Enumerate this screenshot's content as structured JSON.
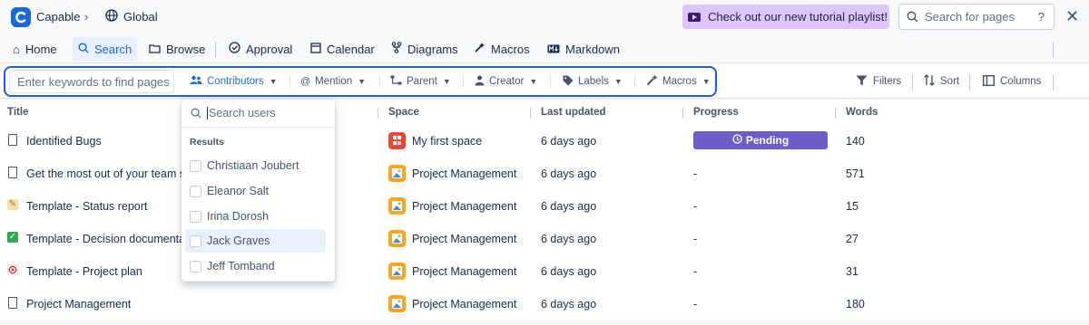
{
  "breadcrumb": {
    "app": "Capable",
    "space": "Global"
  },
  "promo": {
    "label": "Check out our new tutorial playlist!"
  },
  "top_search": {
    "placeholder": "Search for pages",
    "help": "?"
  },
  "nav": {
    "items": [
      {
        "label": "Home",
        "icon": "home-icon"
      },
      {
        "label": "Search",
        "icon": "search-icon",
        "active": true
      },
      {
        "label": "Browse",
        "icon": "folder-icon"
      },
      {
        "label": "Approval",
        "icon": "check-circle-icon"
      },
      {
        "label": "Calendar",
        "icon": "calendar-icon"
      },
      {
        "label": "Diagrams",
        "icon": "diagram-icon"
      },
      {
        "label": "Macros",
        "icon": "wand-icon"
      },
      {
        "label": "Markdown",
        "icon": "markdown-icon"
      }
    ]
  },
  "filters": {
    "keyword_placeholder": "Enter keywords to find pages",
    "chips": [
      {
        "label": "Contributors",
        "icon": "users-icon",
        "active": true
      },
      {
        "label": "Mention",
        "icon": "at-icon"
      },
      {
        "label": "Parent",
        "icon": "hierarchy-icon"
      },
      {
        "label": "Creator",
        "icon": "person-icon"
      },
      {
        "label": "Labels",
        "icon": "tag-icon"
      },
      {
        "label": "Macros",
        "icon": "wand-icon"
      }
    ],
    "right": [
      {
        "label": "Filters",
        "icon": "filter-icon"
      },
      {
        "label": "Sort",
        "icon": "sort-icon"
      },
      {
        "label": "Columns",
        "icon": "columns-icon"
      }
    ]
  },
  "table": {
    "columns": [
      "Title",
      "Space",
      "Last updated",
      "Progress",
      "Words"
    ],
    "rows": [
      {
        "title": "Identified Bugs",
        "icon": "document-icon",
        "space": "My first space",
        "space_icon": "red",
        "updated": "6 days ago",
        "progress": "Pending",
        "words": "140"
      },
      {
        "title": "Get the most out of your team s",
        "icon": "document-icon",
        "space": "Project Management",
        "space_icon": "orange",
        "updated": "6 days ago",
        "progress": "-",
        "words": "571"
      },
      {
        "title": "Template - Status report",
        "icon": "memo-emoji-icon",
        "space": "Project Management",
        "space_icon": "orange",
        "updated": "6 days ago",
        "progress": "-",
        "words": "15"
      },
      {
        "title": "Template - Decision documenta",
        "icon": "check-emoji-icon",
        "space": "Project Management",
        "space_icon": "orange",
        "updated": "6 days ago",
        "progress": "-",
        "words": "27"
      },
      {
        "title": "Template - Project plan",
        "icon": "target-emoji-icon",
        "space": "Project Management",
        "space_icon": "orange",
        "updated": "6 days ago",
        "progress": "-",
        "words": "31"
      },
      {
        "title": "Project Management",
        "icon": "document-icon",
        "space": "Project Management",
        "space_icon": "orange",
        "updated": "6 days ago",
        "progress": "-",
        "words": "180"
      }
    ]
  },
  "dropdown": {
    "placeholder": "Search users",
    "heading": "Results",
    "users": [
      "Christiaan Joubert",
      "Eleanor Salt",
      "Irina Dorosh",
      "Jack Graves",
      "Jeff Tomband"
    ]
  },
  "colors": {
    "accent": "#1868db",
    "outline": "#1f5fd6",
    "pending": "#6e5dc6",
    "promo": "#dcc5fb"
  }
}
